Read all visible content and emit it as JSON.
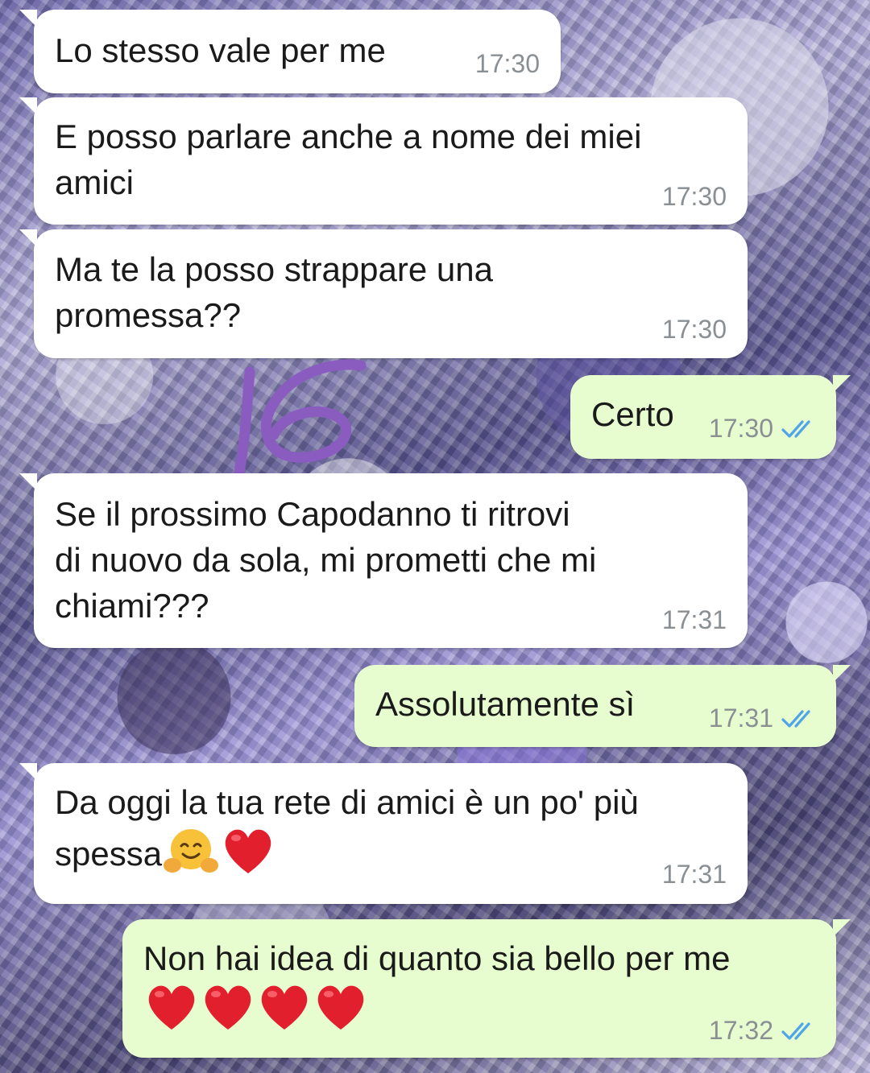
{
  "chat": {
    "messages": [
      {
        "direction": "incoming",
        "text": "Lo stesso vale per me",
        "time": "17:30"
      },
      {
        "direction": "incoming",
        "text": "E posso parlare anche a nome dei miei\namici",
        "time": "17:30"
      },
      {
        "direction": "incoming",
        "text": "Ma te la posso strappare una\npromessa??",
        "time": "17:30"
      },
      {
        "direction": "outgoing",
        "text": "Certo",
        "time": "17:30",
        "status": "read",
        "status_icon": "double-check-icon"
      },
      {
        "direction": "incoming",
        "text": "Se il prossimo Capodanno ti ritrovi\ndi nuovo da sola, mi prometti che mi\nchiami???",
        "time": "17:31"
      },
      {
        "direction": "outgoing",
        "text": "Assolutamente sì",
        "time": "17:31",
        "status": "read",
        "status_icon": "double-check-icon"
      },
      {
        "direction": "incoming",
        "text_line1": "Da oggi la tua rete di amici è un po' più",
        "text_line2": "spessa",
        "emojis": [
          "hugging-face-emoji",
          "red-heart-emoji"
        ],
        "time": "17:31"
      },
      {
        "direction": "outgoing",
        "text": "Non hai idea di quanto sia bello per me",
        "emojis": [
          "red-heart-emoji",
          "red-heart-emoji",
          "red-heart-emoji",
          "red-heart-emoji"
        ],
        "time": "17:32",
        "status": "read",
        "status_icon": "double-check-icon"
      }
    ]
  },
  "overlay": {
    "handwritten_mark": "16",
    "mark_color": "#8a5cc0"
  },
  "colors": {
    "incoming_bubble": "#ffffff",
    "outgoing_bubble": "#e7fccf",
    "timestamp": "#8a8f93",
    "read_tick": "#4fa5e8",
    "heart": "#e21f2d",
    "emoji_face": "#f7c23a"
  }
}
